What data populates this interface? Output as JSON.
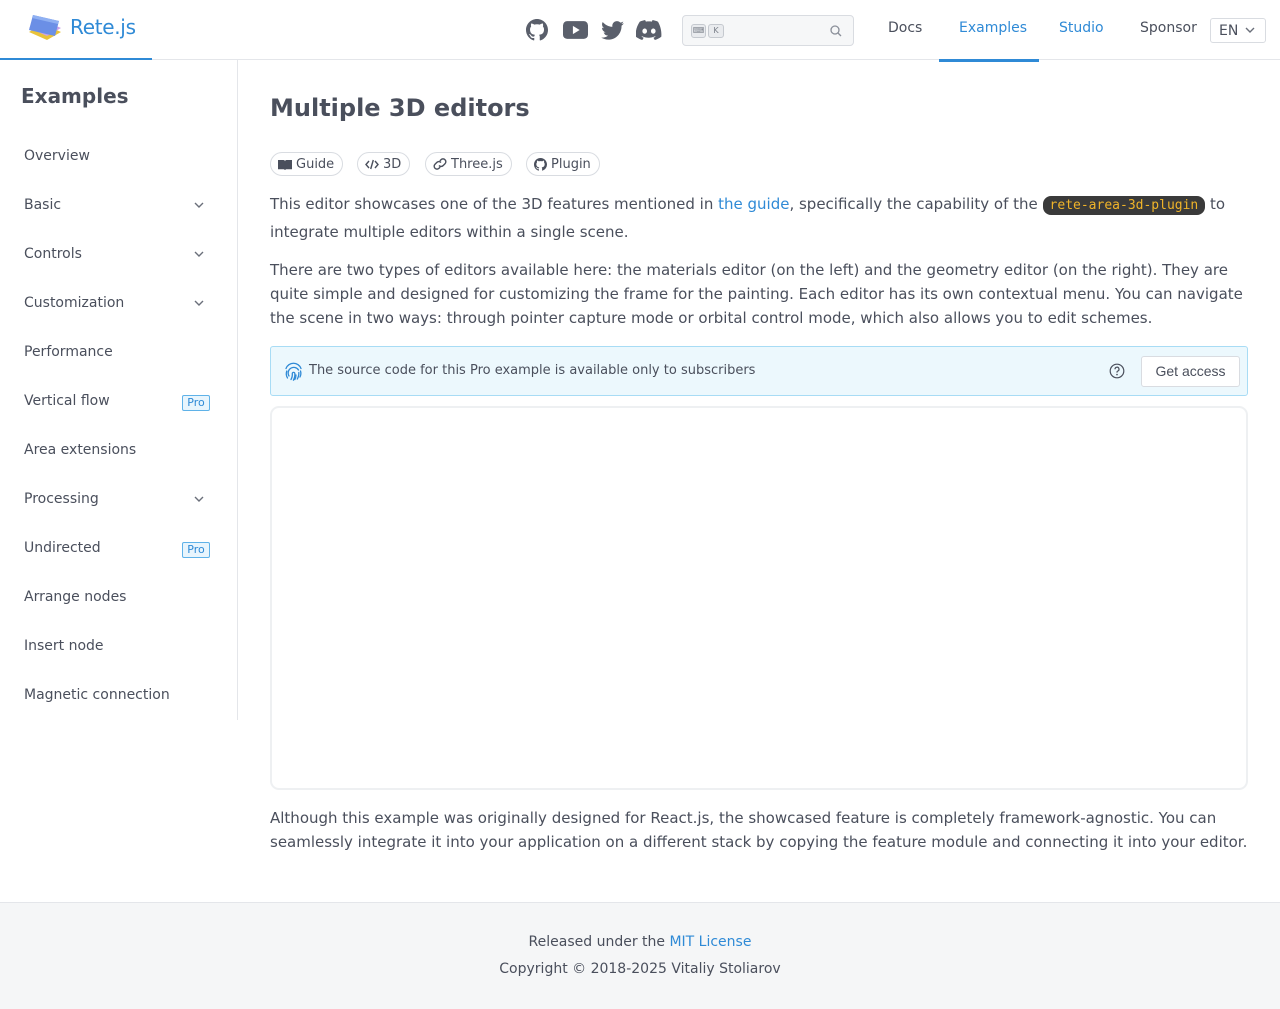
{
  "header": {
    "brand": "Rete.js",
    "search": {
      "kbd1": "⌨",
      "kbd2": "K",
      "placeholder": ""
    },
    "nav": [
      "Docs",
      "Examples",
      "Studio",
      "Sponsor"
    ],
    "active_nav": "Examples",
    "language": "EN",
    "social_icons": [
      "github-icon",
      "youtube-icon",
      "twitter-icon",
      "discord-icon"
    ]
  },
  "sidebar": {
    "title": "Examples",
    "items": [
      {
        "label": "Overview",
        "expandable": false
      },
      {
        "label": "Basic",
        "expandable": true
      },
      {
        "label": "Controls",
        "expandable": true
      },
      {
        "label": "Customization",
        "expandable": true
      },
      {
        "label": "Performance",
        "expandable": false
      },
      {
        "label": "Vertical flow",
        "expandable": false,
        "badge": "Pro"
      },
      {
        "label": "Area extensions",
        "expandable": false
      },
      {
        "label": "Processing",
        "expandable": true
      },
      {
        "label": "Undirected",
        "expandable": false,
        "badge": "Pro"
      },
      {
        "label": "Arrange nodes",
        "expandable": false
      },
      {
        "label": "Insert node",
        "expandable": false
      },
      {
        "label": "Magnetic connection",
        "expandable": false
      }
    ]
  },
  "main": {
    "title": "Multiple 3D editors",
    "chips": [
      {
        "label": "Guide",
        "icon": "book-icon"
      },
      {
        "label": "3D",
        "icon": "code-icon"
      },
      {
        "label": "Three.js",
        "icon": "link-icon"
      },
      {
        "label": "Plugin",
        "icon": "github-icon"
      }
    ],
    "intro": {
      "before_link": "This editor showcases one of the 3D features mentioned in ",
      "link": "the guide",
      "middle": ", specifically the capability of the ",
      "code": "rete-area-3d-plugin",
      "after": " to integrate multiple editors within a single scene."
    },
    "description": "There are two types of editors available here: the materials editor (on the left) and the geometry editor (on the right). They are quite simple and designed for customizing the frame for the painting. Each editor has its own contextual menu. You can navigate the scene in two ways: through pointer capture mode or orbital control mode, which also allows you to edit schemes.",
    "alert": {
      "text": "The source code for this Pro example is available only to subscribers",
      "button": "Get access"
    },
    "outro": "Although this example was originally designed for React.js, the showcased feature is completely framework-agnostic. You can seamlessly integrate it into your application on a different stack by copying the feature module and connecting it into your editor."
  },
  "footer": {
    "released": "Released under the ",
    "license": "MIT License",
    "copyright": "Copyright © 2018-2025 Vitaliy Stoliarov"
  },
  "colors": {
    "accent": "#2f8ad6",
    "text": "#4a4f5c",
    "code_bg": "#3a3a3a",
    "code_fg": "#f0b429",
    "alert_bg": "#ecf8fd"
  }
}
